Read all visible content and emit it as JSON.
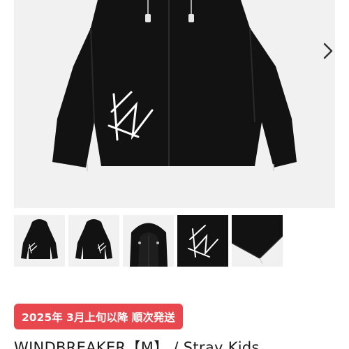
{
  "product": {
    "main_image": {
      "alt": "black windbreaker jacket",
      "icon": "jacket-image"
    },
    "next_icon": "chevron-right-icon",
    "thumbnails": [
      {
        "name": "front"
      },
      {
        "name": "back"
      },
      {
        "name": "hood"
      },
      {
        "name": "logo"
      },
      {
        "name": "hem"
      }
    ],
    "badge": "2025年 3月上旬以降 順次発送",
    "title": "WINDBREAKER【M】 / Stray Kids"
  },
  "colors": {
    "badge_bg": "#e8474d",
    "image_bg": "#f1f1f1",
    "jacket": "#121212"
  }
}
